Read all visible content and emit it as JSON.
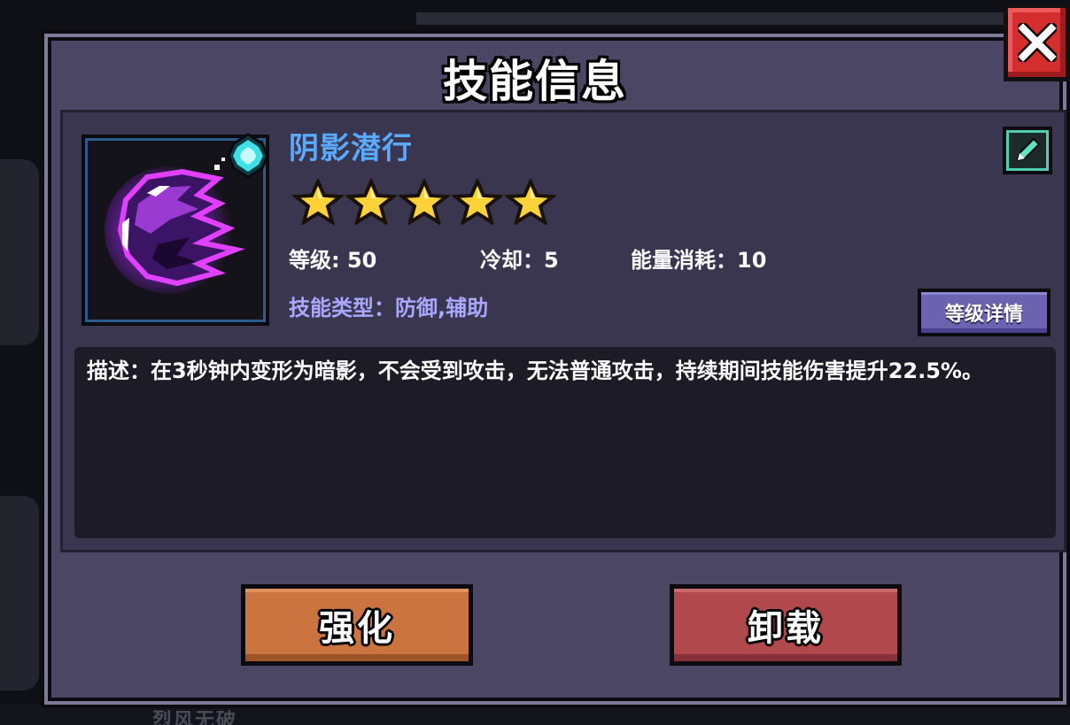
{
  "title": "技能信息",
  "skill": {
    "name": "阴影潜行",
    "stars": 5,
    "level_text": "等级: 50",
    "cooldown_text": "冷却：5",
    "energy_text": "能量消耗：10",
    "type_text": "技能类型：防御,辅助",
    "description": "描述：在3秒钟内变形为暗影，不会受到攻击，无法普通攻击，持续期间技能伤害提升22.5%。"
  },
  "buttons": {
    "level_details": "等级详情",
    "upgrade": "强化",
    "unload": "卸载"
  },
  "background": {
    "bottom_text": "烈风无破"
  },
  "colors": {
    "panel": "#4a4663",
    "skill_name": "#5aa9ff",
    "skill_type": "#a9a7ff",
    "upgrade_button": "#cc7440",
    "unload_button": "#b0484c",
    "close_button": "#d42e2e",
    "skill_icon_glow": "#e040ff"
  },
  "icons": {
    "close": "close-x-icon",
    "edit": "pencil-icon",
    "gem": "cyan-gem-icon",
    "star": "gold-star-icon",
    "skill": "shadow-orb-icon"
  }
}
